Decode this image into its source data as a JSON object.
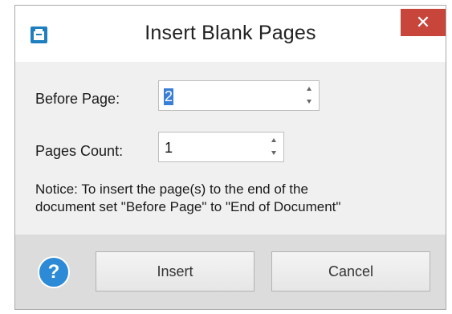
{
  "window": {
    "title": "Insert Blank Pages",
    "close_glyph": "✕",
    "app_icon": "app-icon"
  },
  "form": {
    "before_page": {
      "label": "Before Page:",
      "value": "2"
    },
    "pages_count": {
      "label": "Pages Count:",
      "value": "1"
    },
    "notice_line1": "Notice: To insert the page(s) to the end of the",
    "notice_line2": "document set \"Before Page\" to \"End of Document\""
  },
  "footer": {
    "help_glyph": "?",
    "insert_label": "Insert",
    "cancel_label": "Cancel"
  },
  "colors": {
    "close_button": "#c7453b",
    "help_icon": "#2c8ad6",
    "selection": "#3a7fd6"
  }
}
